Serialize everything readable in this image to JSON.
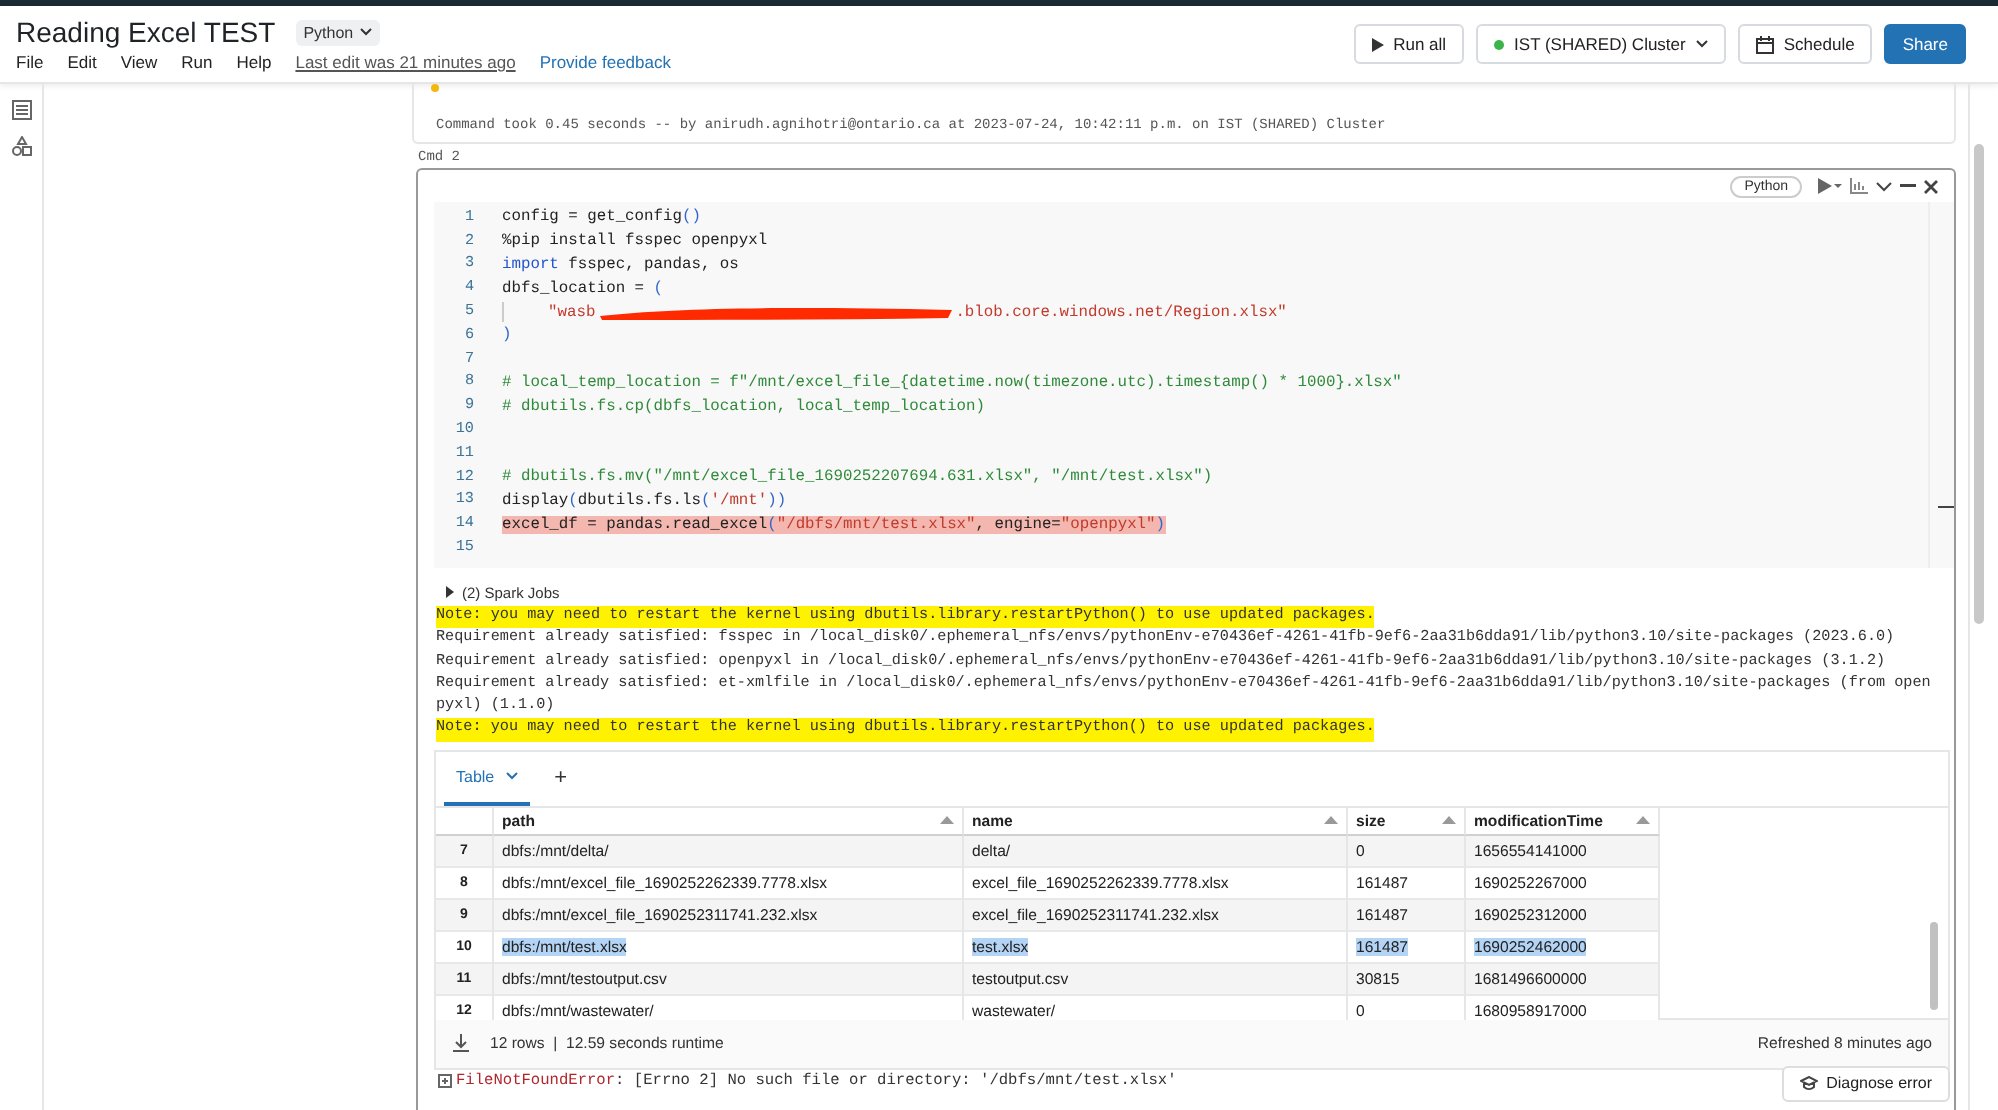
{
  "header": {
    "title": "Reading Excel TEST",
    "language": "Python",
    "menu": [
      "File",
      "Edit",
      "View",
      "Run",
      "Help"
    ],
    "last_edit": "Last edit was 21 minutes ago",
    "feedback": "Provide feedback",
    "buttons": [
      {
        "kind": "run",
        "label": "Run all"
      },
      {
        "kind": "cluster",
        "label": "IST (SHARED) Cluster",
        "color": "#3bb54a"
      },
      {
        "kind": "schedule",
        "label": "Schedule"
      },
      {
        "kind": "share",
        "label": "Share"
      }
    ]
  },
  "previous_cell": {
    "status": "Command took 0.45 seconds -- by anirudh.agnihotri@ontario.ca at 2023-07-24, 10:42:11 p.m. on IST (SHARED) Cluster"
  },
  "cell": {
    "label": "Cmd 2",
    "language": "Python",
    "code": [
      {
        "number": "1",
        "segments": [
          {
            "kind": "plain",
            "text": "config = get_config"
          },
          {
            "kind": "paren",
            "text": "()"
          }
        ]
      },
      {
        "number": "2",
        "segments": [
          {
            "kind": "plain",
            "text": "%pip install fsspec openpyxl"
          }
        ]
      },
      {
        "number": "3",
        "segments": [
          {
            "kind": "keyword",
            "text": "import"
          },
          {
            "kind": "plain",
            "text": " fsspec, pandas, os"
          }
        ]
      },
      {
        "number": "4",
        "segments": [
          {
            "kind": "plain",
            "text": "dbfs_location = "
          },
          {
            "kind": "paren",
            "text": "("
          }
        ]
      },
      {
        "number": "5",
        "segments": [
          {
            "kind": "indent"
          },
          {
            "kind": "string",
            "text": "\"wasb"
          },
          {
            "kind": "redacted"
          },
          {
            "kind": "string",
            "text": ".blob.core.windows.net/Region.xlsx\""
          }
        ]
      },
      {
        "number": "6",
        "segments": [
          {
            "kind": "paren",
            "text": ")"
          }
        ]
      },
      {
        "number": "7"
      },
      {
        "number": "8",
        "segments": [
          {
            "kind": "comment",
            "text": "# local_temp_location = f\"/mnt/excel_file_{datetime.now(timezone.utc).timestamp() * 1000}.xlsx\""
          }
        ]
      },
      {
        "number": "9",
        "segments": [
          {
            "kind": "comment",
            "text": "# dbutils.fs.cp(dbfs_location, local_temp_location)"
          }
        ]
      },
      {
        "number": "10"
      },
      {
        "number": "11"
      },
      {
        "number": "12",
        "segments": [
          {
            "kind": "comment",
            "text": "# dbutils.fs.mv(\"/mnt/excel_file_1690252207694.631.xlsx\", \"/mnt/test.xlsx\")"
          }
        ]
      },
      {
        "number": "13",
        "segments": [
          {
            "kind": "plain",
            "text": "display"
          },
          {
            "kind": "paren",
            "text": "("
          },
          {
            "kind": "plain",
            "text": "dbutils.fs.ls"
          },
          {
            "kind": "paren",
            "text": "("
          },
          {
            "kind": "string",
            "text": "'/mnt'"
          },
          {
            "kind": "paren",
            "text": "))"
          }
        ]
      },
      {
        "number": "14",
        "highlighted": true,
        "segments": [
          {
            "kind": "plain",
            "text": "excel_df = pandas.read_excel"
          },
          {
            "kind": "paren",
            "text": "("
          },
          {
            "kind": "string",
            "text": "\"/dbfs/mnt/test.xlsx\""
          },
          {
            "kind": "plain",
            "text": ", engine="
          },
          {
            "kind": "string",
            "text": "\"openpyxl\""
          },
          {
            "kind": "paren",
            "text": ")"
          }
        ]
      },
      {
        "number": "15"
      }
    ],
    "spark_jobs": "(2) Spark Jobs",
    "output": [
      {
        "kind": "note",
        "text": "Note: you may need to restart the kernel using dbutils.library.restartPython() to use updated packages."
      },
      {
        "kind": "plain",
        "text": "Requirement already satisfied: fsspec in /local_disk0/.ephemeral_nfs/envs/pythonEnv-e70436ef-4261-41fb-9ef6-2aa31b6dda91/lib/python3.10/site-packages (2023.6.0)"
      },
      {
        "kind": "plain",
        "text": "Requirement already satisfied: openpyxl in /local_disk0/.ephemeral_nfs/envs/pythonEnv-e70436ef-4261-41fb-9ef6-2aa31b6dda91/lib/python3.10/site-packages (3.1.2)"
      },
      {
        "kind": "plain",
        "text": "Requirement already satisfied: et-xmlfile in /local_disk0/.ephemeral_nfs/envs/pythonEnv-e70436ef-4261-41fb-9ef6-2aa31b6dda91/lib/python3.10/site-packages (from open"
      },
      {
        "kind": "plain",
        "text": "pyxl) (1.1.0)"
      },
      {
        "kind": "note",
        "text": "Note: you may need to restart the kernel using dbutils.library.restartPython() to use updated packages."
      }
    ],
    "result": {
      "tabs": [
        {
          "label": "Table",
          "selected": true
        }
      ],
      "add_tab": "+",
      "table": {
        "columns": [
          "path",
          "name",
          "size",
          "modificationTime"
        ],
        "rows": [
          {
            "index": "7",
            "selected": false,
            "cells": [
              "dbfs:/mnt/delta/",
              "delta/",
              "0",
              "1656554141000"
            ]
          },
          {
            "index": "8",
            "selected": false,
            "cells": [
              "dbfs:/mnt/excel_file_1690252262339.7778.xlsx",
              "excel_file_1690252262339.7778.xlsx",
              "161487",
              "1690252267000"
            ]
          },
          {
            "index": "9",
            "selected": false,
            "cells": [
              "dbfs:/mnt/excel_file_1690252311741.232.xlsx",
              "excel_file_1690252311741.232.xlsx",
              "161487",
              "1690252312000"
            ]
          },
          {
            "index": "10",
            "selected": true,
            "cells": [
              "dbfs:/mnt/test.xlsx",
              "test.xlsx",
              "161487",
              "1690252462000"
            ]
          },
          {
            "index": "11",
            "selected": false,
            "cells": [
              "dbfs:/mnt/testoutput.csv",
              "testoutput.csv",
              "30815",
              "1681496600000"
            ]
          },
          {
            "index": "12",
            "selected": false,
            "cells": [
              "dbfs:/mnt/wastewater/",
              "wastewater/",
              "0",
              "1680958917000"
            ]
          }
        ]
      },
      "summary": "12 rows  |  12.59 seconds runtime",
      "refreshed": "Refreshed 8 minutes ago"
    },
    "error": {
      "type": "FileNotFoundError",
      "message": ": [Errno 2] No such file or directory: '/dbfs/mnt/test.xlsx'"
    },
    "diagnose": "Diagnose error"
  }
}
